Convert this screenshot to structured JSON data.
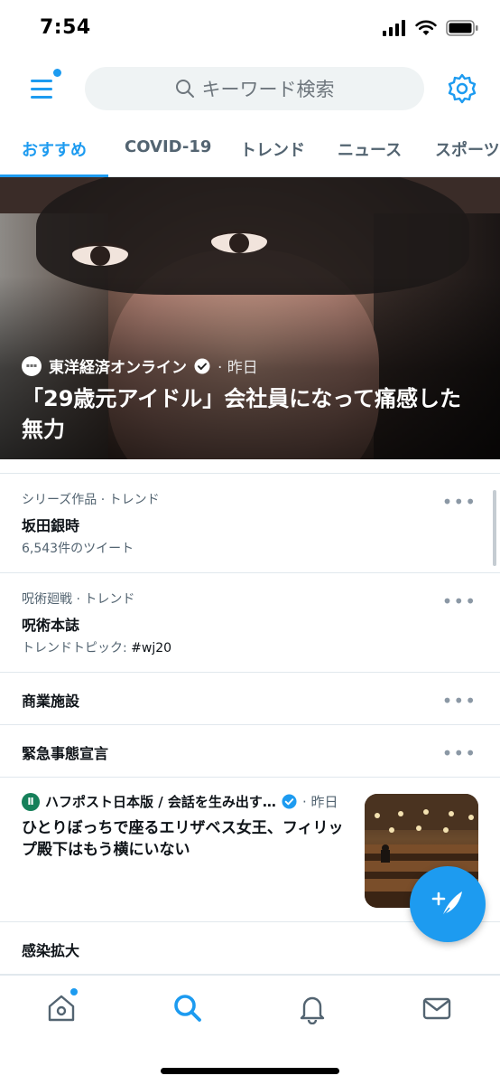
{
  "status_bar": {
    "time": "7:54"
  },
  "header": {
    "search_placeholder": "キーワード検索"
  },
  "tabs": [
    {
      "label": "おすすめ",
      "active": true
    },
    {
      "label": "COVID-19"
    },
    {
      "label": "トレンド"
    },
    {
      "label": "ニュース"
    },
    {
      "label": "スポーツ"
    }
  ],
  "hero": {
    "source": "東洋経済オンライン",
    "time": "· 昨日",
    "title": "「29歳元アイドル」会社員になって痛感した無力"
  },
  "trends": [
    {
      "meta": "シリーズ作品 · トレンド",
      "title": "坂田銀時",
      "sub": "6,543件のツイート"
    },
    {
      "meta": "呪術廻戦 · トレンド",
      "title": "呪術本誌",
      "sub_prefix": "トレンドトピック: ",
      "sub_tag": "#wj20"
    },
    {
      "title": "商業施設"
    },
    {
      "title": "緊急事態宣言"
    }
  ],
  "news": {
    "source": "ハフポスト日本版 / 会話を生み出す…",
    "time": "· 昨日",
    "title": "ひとりぼっちで座るエリザベス女王、フィリップ殿下はもう横にいない"
  },
  "last_trend": {
    "title": "感染拡大"
  },
  "more_label": "•••",
  "colors": {
    "accent": "#1d9bf0",
    "text": "#0f1419",
    "secondary": "#536471"
  }
}
